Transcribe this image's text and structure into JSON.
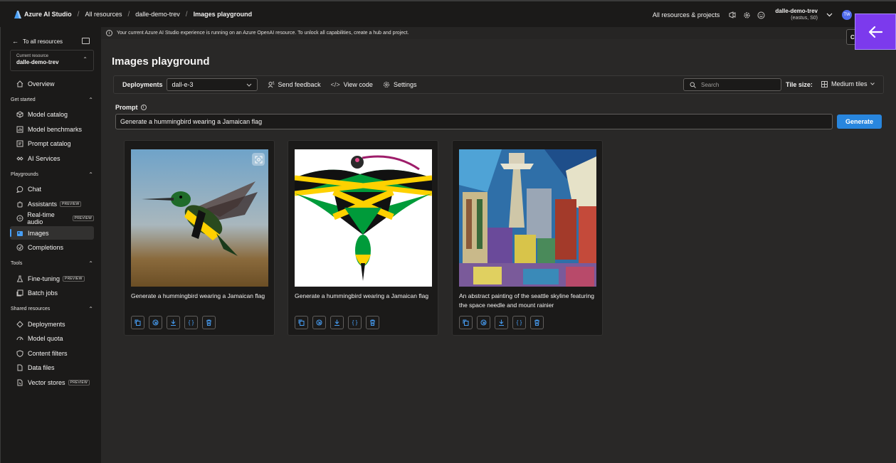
{
  "topbar": {
    "app_name": "Azure AI Studio",
    "breadcrumbs": [
      "All resources",
      "dalle-demo-trev",
      "Images playground"
    ],
    "separator": "/",
    "projects_link": "All resources & projects",
    "account_name": "dalle-demo-trev",
    "account_region": "(eastus, S0)",
    "avatar_initials": "TW"
  },
  "sidebar": {
    "back_label": "To all resources",
    "resource_label": "Current resource",
    "resource_name": "dalle-demo-trev",
    "overview": "Overview",
    "sections": [
      {
        "title": "Get started",
        "items": [
          "Model catalog",
          "Model benchmarks",
          "Prompt catalog",
          "AI Services"
        ]
      },
      {
        "title": "Playgrounds",
        "items": [
          "Chat",
          "Assistants",
          "Real-time audio",
          "Images",
          "Completions"
        ]
      },
      {
        "title": "Tools",
        "items": [
          "Fine-tuning",
          "Batch jobs"
        ]
      },
      {
        "title": "Shared resources",
        "items": [
          "Deployments",
          "Model quota",
          "Content filters",
          "Data files",
          "Vector stores"
        ]
      }
    ],
    "badge": "PREVIEW",
    "active_item": "Images"
  },
  "banner": {
    "text": "Your current Azure AI Studio experience is running on an Azure OpenAI resource. To unlock all capabilities, create a hub and project.",
    "create_label": "Cre"
  },
  "main": {
    "title": "Images playground",
    "toolbar": {
      "deployments_label": "Deployments",
      "deployment_value": "dall-e-3",
      "send_feedback": "Send feedback",
      "view_code": "View code",
      "settings": "Settings",
      "search_placeholder": "Search",
      "tile_size_label": "Tile size:",
      "tile_size_value": "Medium tiles"
    },
    "prompt_label": "Prompt",
    "prompt_value": "Generate a hummingbird wearing a Jamaican flag",
    "generate_label": "Generate",
    "cards": [
      {
        "caption": "Generate a hummingbird wearing a Jamaican flag",
        "image": "hummingbird-photo"
      },
      {
        "caption": "Generate a hummingbird wearing a Jamaican flag",
        "image": "hummingbird-flag-illustration"
      },
      {
        "caption": "An abstract painting of the seattle skyline featuring the space needle and mount rainier",
        "image": "seattle-abstract-painting"
      }
    ],
    "card_actions": [
      "copy-icon",
      "variation-icon",
      "download-icon",
      "code-icon",
      "delete-icon"
    ]
  },
  "colors": {
    "accent": "#479ef5",
    "generate_button": "#2886de",
    "overlay_button": "#7c3aed",
    "jamaica_green": "#009b3a",
    "jamaica_gold": "#fed100"
  }
}
